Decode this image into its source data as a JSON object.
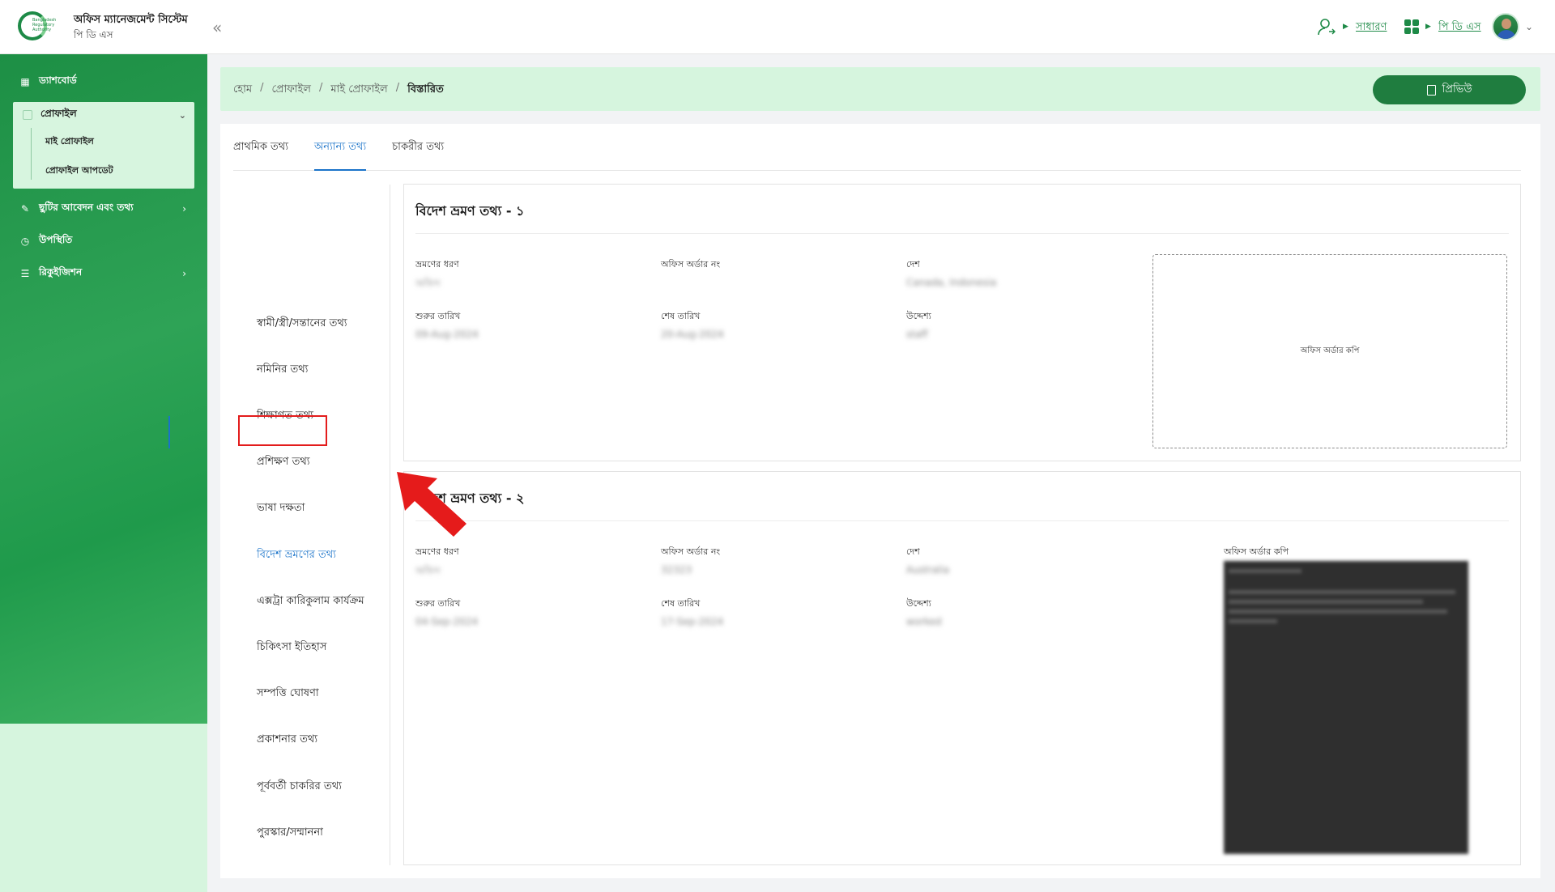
{
  "header": {
    "app_title": "অফিস ম্যানেজমেন্ট সিস্টেম",
    "app_subtitle": "পি ডি এস",
    "logo_text": "Bangladesh Regulatory Authority",
    "collapse_icon": "double-chevron-left-icon",
    "role_label": "সাধারণ",
    "module_label": "পি ডি এস"
  },
  "sidebar": {
    "items": [
      {
        "label": "ড্যাশবোর্ড",
        "icon": "dashboard-icon"
      },
      {
        "label": "ছুটির আবেদন এবং তথ্য",
        "icon": "leave-icon"
      },
      {
        "label": "উপস্থিতি",
        "icon": "clock-icon"
      },
      {
        "label": "রিকুইজিশন",
        "icon": "requisition-icon"
      }
    ],
    "profile_menu": {
      "label": "প্রোফাইল",
      "children": [
        "মাই প্রোফাইল",
        "প্রোফাইল আপডেট"
      ]
    }
  },
  "breadcrumb": [
    "হোম",
    "প্রোফাইল",
    "মাই প্রোফাইল",
    "বিস্তারিত"
  ],
  "preview_button": "প্রিভিউ",
  "tabs": [
    "প্রাথমিক তথ্য",
    "অন্যান্য তথ্য",
    "চাকরীর তথ্য"
  ],
  "active_tab": "অন্যান্য তথ্য",
  "left_nav": [
    "স্বামী/স্ত্রী/সন্তানের তথ্য",
    "নমিনির তথ্য",
    "শিক্ষাগত তথ্য",
    "প্রশিক্ষণ তথ্য",
    "ভাষা দক্ষতা",
    "বিদেশ ভ্রমণের তথ্য",
    "এক্সট্রা কারিকুলাম কার্যক্রম",
    "চিকিৎসা ইতিহাস",
    "সম্পত্তি ঘোষণা",
    "প্রকাশনার তথ্য",
    "পূর্ববর্তী চাকরির তথ্য",
    "পুরস্কার/সম্মাননা"
  ],
  "active_left_nav": "বিদেশ ভ্রমণের তথ্য",
  "labels": {
    "travel_type": "ভ্রমণের ধরণ",
    "office_order_no": "অফিস অর্ডার নং",
    "country": "দেশ",
    "start_date": "শুরুর তারিখ",
    "end_date": "শেষ তারিখ",
    "purpose": "উদ্দেশ্য",
    "office_order_copy": "অফিস অর্ডার কপি"
  },
  "travels": [
    {
      "title": "বিদেশ ভ্রমণ তথ্য - ১",
      "travel_type": "অফিস",
      "office_order_no": "",
      "country": "Canada, Indonesia",
      "start_date": "09-Aug-2024",
      "end_date": "20-Aug-2024",
      "purpose": "staff"
    },
    {
      "title": "বিদেশ ভ্রমণ তথ্য - ২",
      "travel_type": "অফিস",
      "office_order_no": "32323",
      "country": "Australia",
      "start_date": "04-Sep-2024",
      "end_date": "17-Sep-2024",
      "purpose": "worked"
    }
  ]
}
